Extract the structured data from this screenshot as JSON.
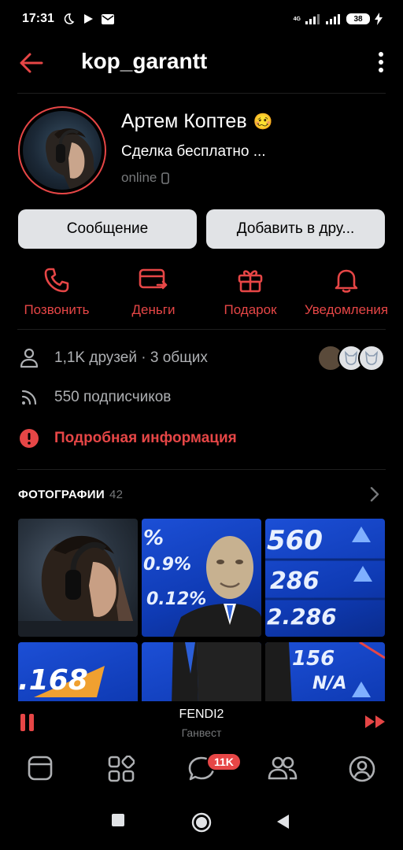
{
  "status_bar": {
    "time": "17:31",
    "network": "4G",
    "battery": "38",
    "icons": [
      "moon-icon",
      "play-icon",
      "mail-icon",
      "signal-icon",
      "signal-icon",
      "charging-icon"
    ]
  },
  "header": {
    "title": "kop_garantt",
    "back_icon": "arrow-left-icon",
    "more_icon": "more-vertical-icon"
  },
  "profile": {
    "name": "Артем Коптев",
    "name_emoji": "🥴",
    "status": "Сделка бесплатно ...",
    "online": "online",
    "online_icon": "phone-icon"
  },
  "buttons": {
    "message": "Сообщение",
    "add_friend": "Добавить в дру..."
  },
  "actions": [
    {
      "label": "Позвонить",
      "icon": "phone-call-icon"
    },
    {
      "label": "Деньги",
      "icon": "card-transfer-icon"
    },
    {
      "label": "Подарок",
      "icon": "gift-icon"
    },
    {
      "label": "Уведомления",
      "icon": "bell-icon"
    }
  ],
  "info": {
    "friends": "1,1K друзей · 3 общих",
    "subscribers": "550 подписчиков",
    "details": "Подробная информация"
  },
  "photos": {
    "title": "ФОТОГРАФИИ",
    "count": "42",
    "board_numbers": [
      "%",
      "0.9%",
      "0.12%",
      "560",
      "286",
      "2.286",
      "0.156",
      ".168",
      "N/A"
    ]
  },
  "player": {
    "track": "FENDI2",
    "artist": "Ганвест"
  },
  "tabbar": {
    "badge": "11K",
    "tabs": [
      "feed-icon",
      "services-icon",
      "messages-icon",
      "friends-icon",
      "profile-icon"
    ]
  },
  "colors": {
    "accent": "#e64646",
    "background": "#000000",
    "button_bg": "#e1e3e6",
    "secondary_text": "#76787a"
  }
}
